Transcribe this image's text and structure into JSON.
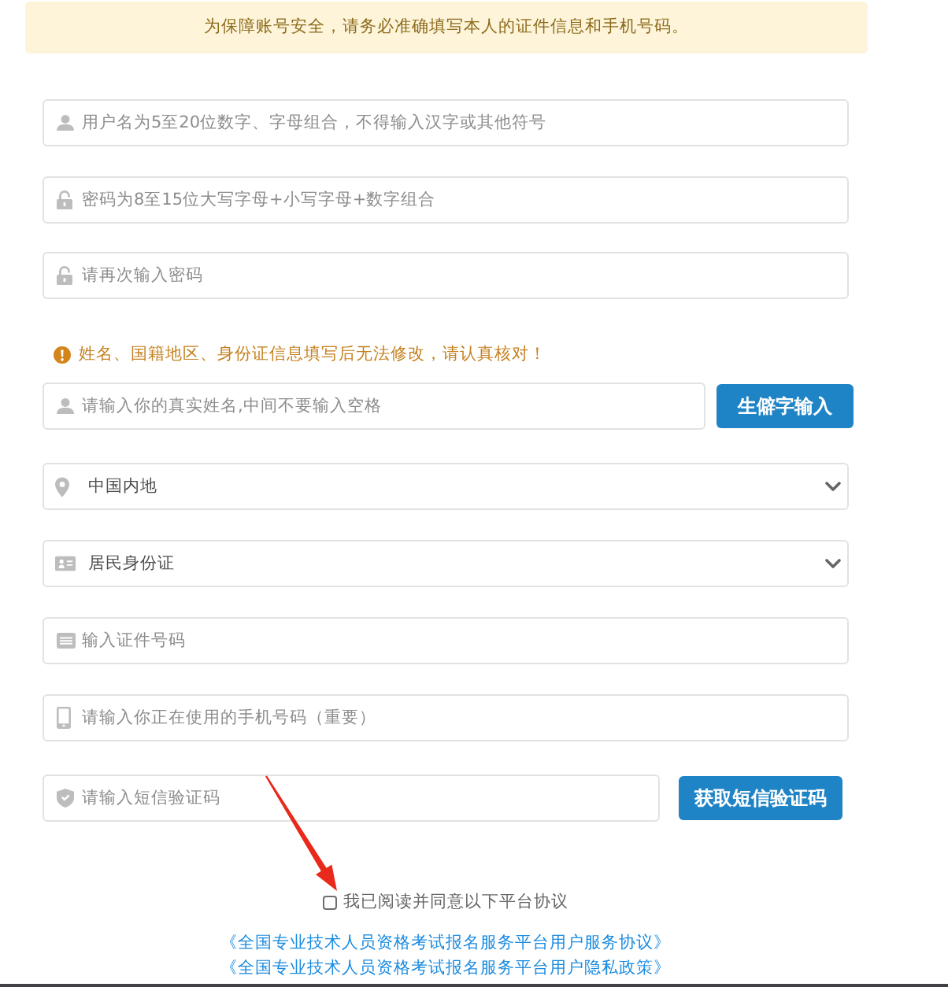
{
  "notice": "为保障账号安全，请务必准确填写本人的证件信息和手机号码。",
  "account": [
    {
      "placeholder": "用户名为5至20位数字、字母组合，不得输入汉字或其他符号"
    },
    {
      "placeholder": "密码为8至15位大写字母+小写字母+数字组合"
    },
    {
      "placeholder": "请再次输入密码"
    }
  ],
  "warning": "姓名、国籍地区、身份证信息填写后无法修改，请认真核对！",
  "name_field": {
    "placeholder": "请输入你的真实姓名,中间不要输入空格",
    "button": "生僻字输入"
  },
  "region_select": {
    "value": "中国内地"
  },
  "id_type_select": {
    "value": "居民身份证"
  },
  "id_number_field": {
    "placeholder": "输入证件号码"
  },
  "phone_field": {
    "placeholder": "请输入你正在使用的手机号码（重要）"
  },
  "sms_field": {
    "placeholder": "请输入短信验证码",
    "button": "获取短信验证码"
  },
  "agreement": {
    "label": "我已阅读并同意以下平台协议",
    "checked": false
  },
  "links": [
    "《全国专业技术人员资格考试报名服务平台用户服务协议》",
    "《全国专业技术人员资格考试报名服务平台用户隐私政策》"
  ]
}
